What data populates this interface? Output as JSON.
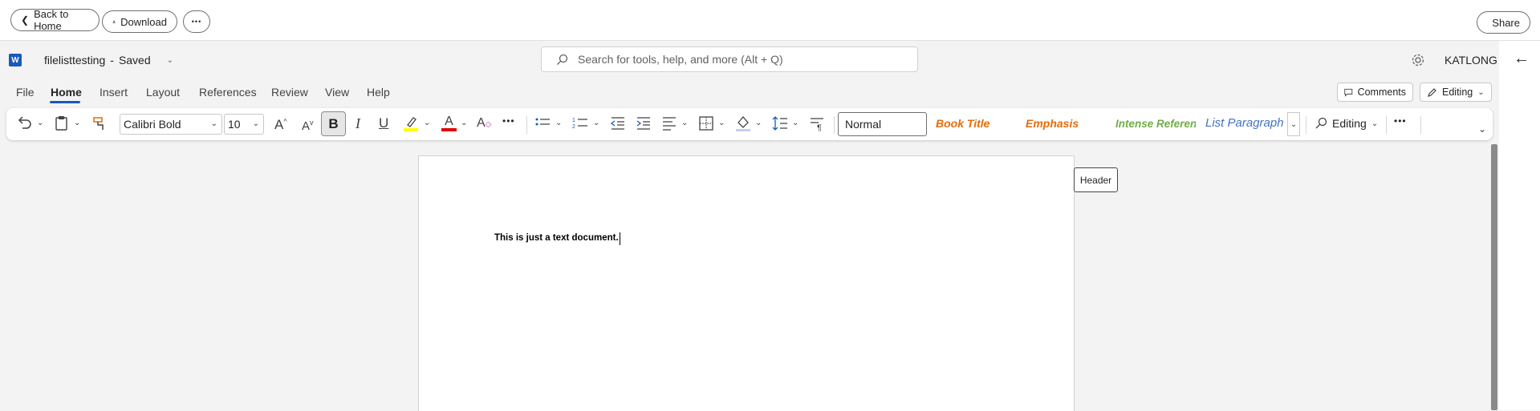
{
  "topbar": {
    "back_label": "Back to Home",
    "download_label": "Download",
    "more_label": "•••",
    "share_label": "Share"
  },
  "officebar": {
    "app_icon": "word-icon",
    "file_name": "filelisttesting",
    "separator": "-",
    "save_status": "Saved",
    "search_placeholder": "Search for tools, help, and more (Alt + Q)",
    "user_name": "KATLONG"
  },
  "tabs": [
    "File",
    "Home",
    "Insert",
    "Layout",
    "References",
    "Review",
    "View",
    "Help"
  ],
  "active_tab": "Home",
  "tab_actions": {
    "comments_label": "Comments",
    "editing_label": "Editing"
  },
  "ribbon": {
    "font_name": "Calibri Bold",
    "font_size": "10",
    "bold_label": "B",
    "italic_label": "I",
    "underline_label": "U",
    "styles": [
      {
        "label": "Normal",
        "color": "#242424"
      },
      {
        "label": "Book Title",
        "color": "#e46c0a"
      },
      {
        "label": "Emphasis",
        "color": "#e46c0a"
      },
      {
        "label": "Intense Referenc",
        "color": "#70ad47"
      },
      {
        "label": "List Paragraph",
        "color": "#4472c4"
      }
    ],
    "editing_mode_label": "Editing",
    "more_label": "•••"
  },
  "document": {
    "body_text": "This is just a text document.",
    "header_tag": "Header"
  },
  "colors": {
    "accent": "#185abd",
    "highlight_yellow": "#ffff00",
    "font_red": "#e00000"
  }
}
